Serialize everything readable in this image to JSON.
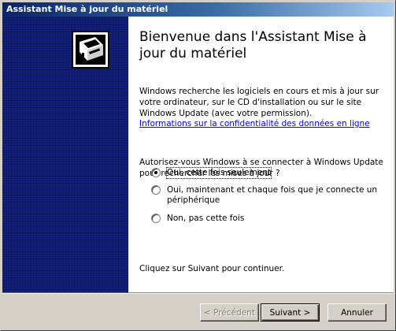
{
  "window": {
    "title": "Assistant Mise à jour du matériel"
  },
  "banner": {
    "icon": "hardware-install-icon",
    "color": "#0c1a73"
  },
  "main": {
    "heading": "Bienvenue dans l'Assistant Mise à jour du matériel",
    "description": "Windows recherche les logiciels en cours et mis à jour sur votre ordinateur, sur le CD d'installation ou sur le site Windows Update (avec votre permission).",
    "privacy_link": "Informations sur la confidentialité des données en ligne",
    "question": "Autorisez-vous Windows à se connecter à Windows Update pour rechercher les mises à jour ?",
    "options": [
      {
        "label": "Oui, cette fois seulement",
        "checked": true
      },
      {
        "label": "Oui, maintenant et chaque fois que je connecte un périphérique",
        "checked": false
      },
      {
        "label": "Non, pas cette fois",
        "checked": false
      }
    ],
    "continue_text": "Cliquez sur Suivant pour continuer."
  },
  "buttons": {
    "back": "< Précédent",
    "next": "Suivant >",
    "cancel": "Annuler"
  }
}
